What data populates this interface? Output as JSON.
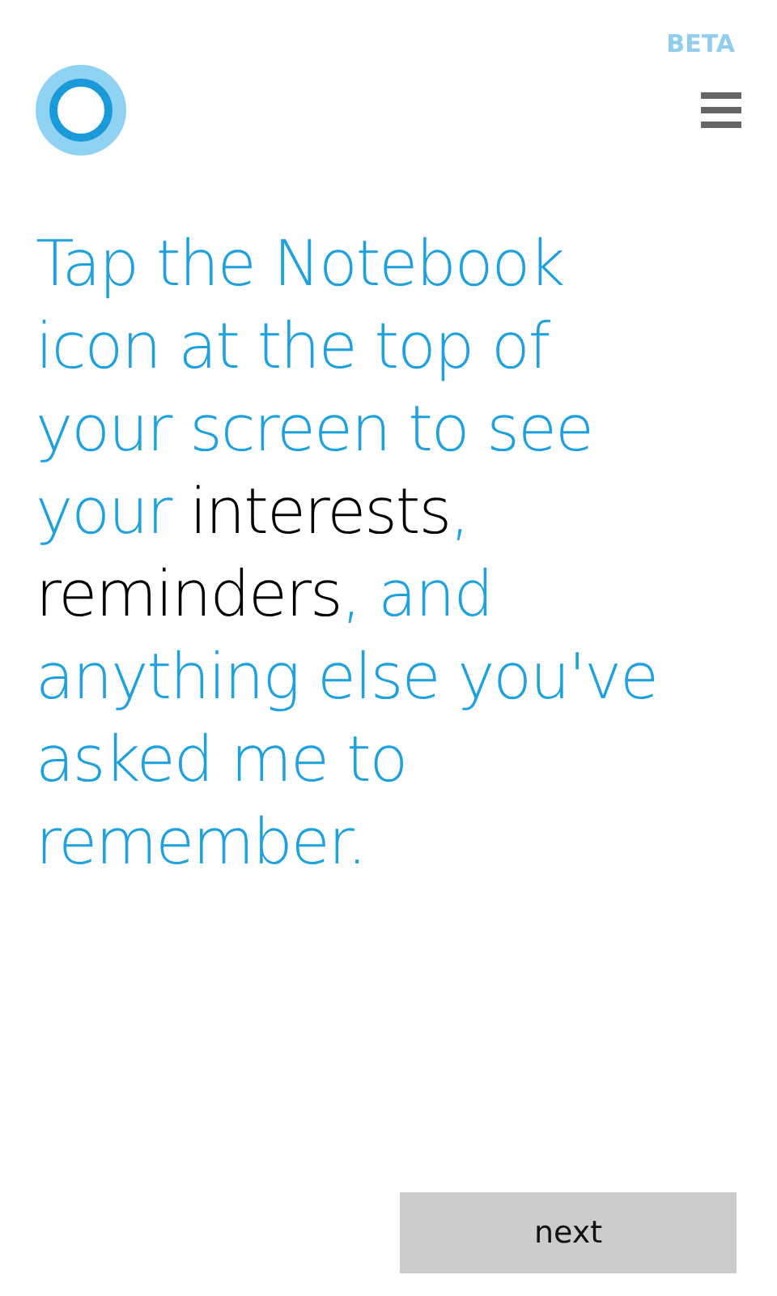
{
  "badge": "BETA",
  "message": [
    {
      "text": "Tap the Notebook icon at the top of your screen to see your ",
      "highlight": false
    },
    {
      "text": "interests",
      "highlight": true
    },
    {
      "text": ", ",
      "highlight": false
    },
    {
      "text": "reminders",
      "highlight": true
    },
    {
      "text": ", and anything else you've asked me to remember.",
      "highlight": false
    }
  ],
  "next_button": "next"
}
